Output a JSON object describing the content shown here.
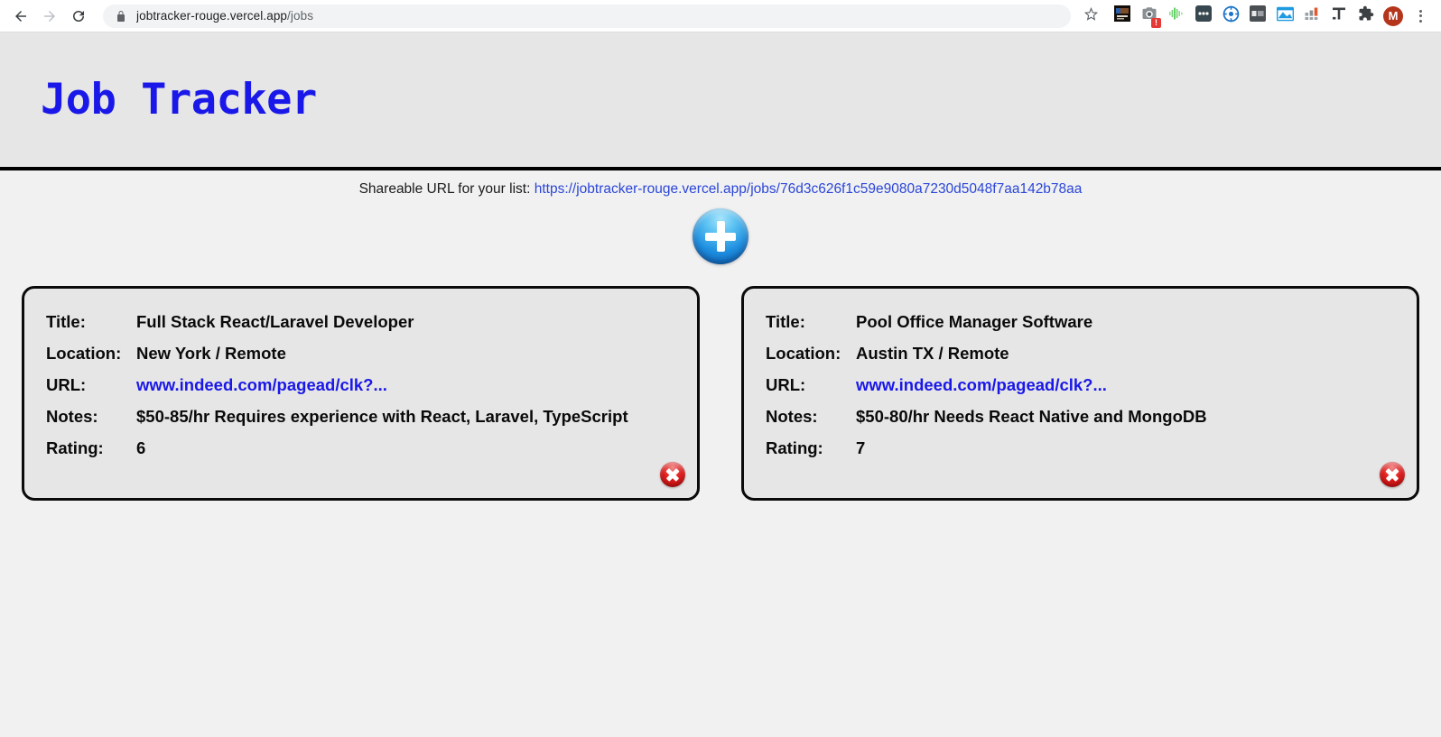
{
  "browser": {
    "back_icon": "back-arrow-icon",
    "forward_icon": "forward-arrow-icon",
    "reload_icon": "reload-icon",
    "lock_icon": "lock-icon",
    "url_main": "jobtracker-rouge.vercel.app",
    "url_path": "/jobs",
    "star_icon": "bookmark-star-icon",
    "extensions": [
      {
        "name": "dark-thumbnail-extension-icon",
        "badge": ""
      },
      {
        "name": "camera-extension-icon",
        "badge": "!"
      },
      {
        "name": "audio-waveform-extension-icon",
        "badge": ""
      },
      {
        "name": "dots-extension-icon",
        "badge": ""
      },
      {
        "name": "blue-target-extension-icon",
        "badge": ""
      },
      {
        "name": "grey-tag-extension-icon",
        "badge": ""
      },
      {
        "name": "blue-window-extension-icon",
        "badge": ""
      },
      {
        "name": "bar-chart-extension-icon",
        "badge": ""
      },
      {
        "name": "t-letter-extension-icon",
        "badge": ""
      },
      {
        "name": "puzzle-extensions-icon",
        "badge": ""
      }
    ],
    "profile_initial": "M",
    "menu_icon": "kebab-menu-icon"
  },
  "header": {
    "title": "Job Tracker",
    "title_color": "#1a18e8",
    "background": "#e6e6e6"
  },
  "share": {
    "label": "Shareable URL for your list:",
    "url": "https://jobtracker-rouge.vercel.app/jobs/76d3c626f1c59e9080a7230d5048f7aa142b78aa",
    "link_color": "#2b46d8"
  },
  "add_button": {
    "name": "add-job-button",
    "icon": "plus-icon",
    "color": "#1f8fe0"
  },
  "labels": {
    "title": "Title:",
    "location": "Location:",
    "url": "URL:",
    "notes": "Notes:",
    "rating": "Rating:"
  },
  "delete_icon": "delete-x-icon",
  "jobs": [
    {
      "title": "Full Stack React/Laravel Developer",
      "location": "New York / Remote",
      "url": "www.indeed.com/pagead/clk?...",
      "notes": "$50-85/hr Requires experience with React, Laravel, TypeScript",
      "rating": "6"
    },
    {
      "title": "Pool Office Manager Software",
      "location": "Austin TX / Remote",
      "url": "www.indeed.com/pagead/clk?...",
      "notes": "$50-80/hr Needs React Native and MongoDB",
      "rating": "7"
    }
  ]
}
